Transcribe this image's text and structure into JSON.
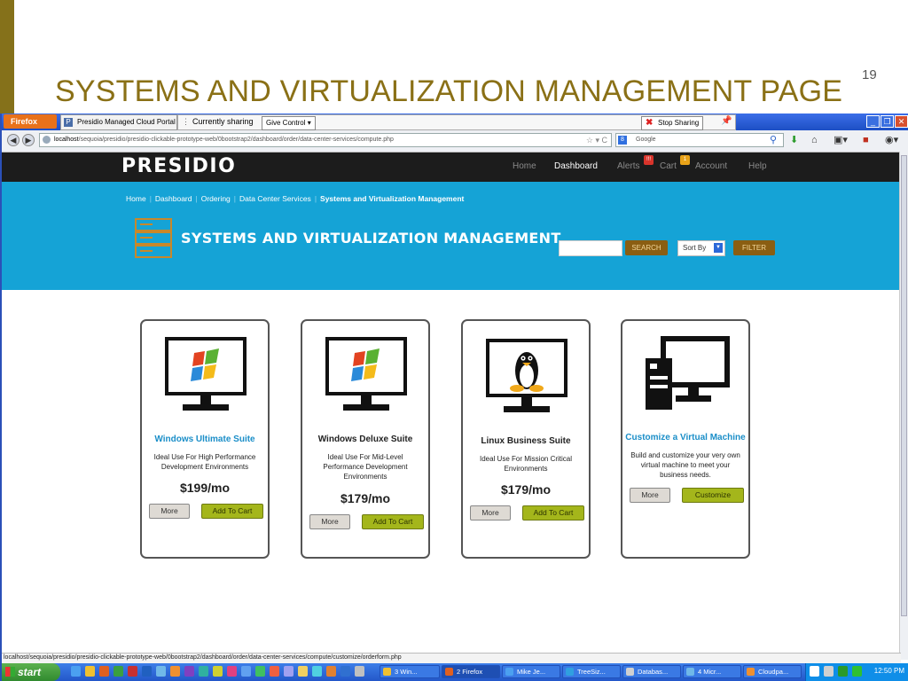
{
  "slide": {
    "title": "SYSTEMS AND VIRTUALIZATION MANAGEMENT PAGE",
    "page_number": "19"
  },
  "browser": {
    "firefox_menu": "Firefox",
    "tab_label": "Presidio Managed Cloud Portal - (",
    "tab_favicon": "P",
    "sharing_status": "Currently sharing",
    "give_control": "Give Control",
    "stop_sharing": "Stop Sharing",
    "url_host": "localhost",
    "url_path": "/sequoia/presidio/presidio-clickable-prototype-web/0bootstrap2/dashboard/order/data-center-services/compute.php",
    "search_engine": "Google",
    "status_url": "localhost/sequoia/presidio/presidio-clickable-prototype-web/0bootstrap2/dashboard/order/data-center-services/compute/customize/orderform.php"
  },
  "site": {
    "logo": "PRESIDIO",
    "nav": {
      "home": "Home",
      "dashboard": "Dashboard",
      "alerts": "Alerts",
      "alerts_badge": "!!!",
      "cart": "Cart",
      "cart_badge": "1",
      "account": "Account",
      "help": "Help"
    },
    "breadcrumb": {
      "home": "Home",
      "dashboard": "Dashboard",
      "ordering": "Ordering",
      "dcs": "Data Center Services",
      "current": "Systems and Virtualization Management"
    },
    "page_title": "SYSTEMS AND VIRTUALIZATION MANAGEMENT",
    "search_button": "SEARCH",
    "sort_by": "Sort By",
    "filter_button": "FILTER",
    "accent_color": "#15a3d6",
    "cart_button_color": "#a4b61b"
  },
  "products": [
    {
      "title": "Windows Ultimate Suite",
      "desc": "Ideal Use For High Performance Development Environments",
      "price": "$199/mo",
      "more": "More",
      "action": "Add To Cart",
      "icon": "windows-monitor-icon"
    },
    {
      "title": "Windows Deluxe Suite",
      "desc": "Ideal Use For Mid-Level Performance Development Environments",
      "price": "$179/mo",
      "more": "More",
      "action": "Add To Cart",
      "icon": "windows-monitor-icon"
    },
    {
      "title": "Linux Business Suite",
      "desc": "Ideal Use For Mission Critical Environments",
      "price": "$179/mo",
      "more": "More",
      "action": "Add To Cart",
      "icon": "linux-monitor-icon"
    },
    {
      "title": "Customize a Virtual Machine",
      "desc": "Build and customize your very own virtual machine to meet your business needs.",
      "more": "More",
      "action": "Customize",
      "icon": "desktop-tower-icon"
    }
  ],
  "taskbar": {
    "start": "start",
    "tasks": [
      "3 Win...",
      "2 Firefox",
      "Mike Je...",
      "TreeSiz...",
      "Databas...",
      "4 Micr...",
      "Cloudpa..."
    ],
    "clock": "12:50 PM"
  }
}
